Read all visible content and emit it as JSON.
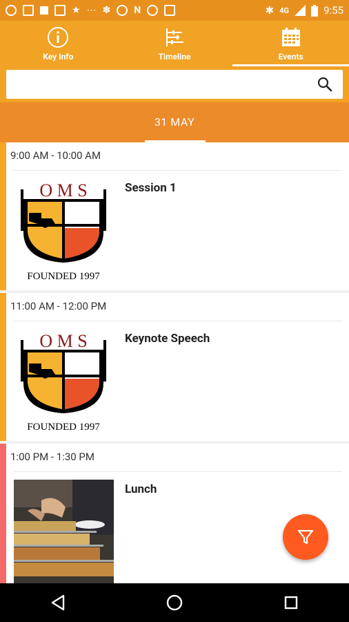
{
  "status_bar": {
    "time": "9:55",
    "network": "4G",
    "left_icons": [
      "whatsapp-icon",
      "gmail-icon",
      "square-icon",
      "gmail-icon",
      "star-icon",
      "dots-icon",
      "paw-icon",
      "reddit-icon",
      "n-icon",
      "google-icon",
      "news-icon"
    ],
    "right_icons": [
      "bluetooth-icon",
      "signal-icon",
      "battery-icon"
    ]
  },
  "tabs": [
    {
      "label": "Key Info",
      "icon": "info-icon",
      "active": false
    },
    {
      "label": "Timeline",
      "icon": "timeline-icon",
      "active": false
    },
    {
      "label": "Events",
      "icon": "calendar-icon",
      "active": true
    }
  ],
  "search": {
    "placeholder": "",
    "value": "",
    "icon": "search-icon"
  },
  "date_tab": {
    "label": "31 MAY"
  },
  "events": [
    {
      "time": "9:00 AM - 10:00 AM",
      "title": "Session 1",
      "image": "oms-logo",
      "stripe_color": "#f5a623"
    },
    {
      "time": "11:00 AM - 12:00 PM",
      "title": "Keynote Speech",
      "image": "oms-logo",
      "stripe_color": "#f5a623"
    },
    {
      "time": "1:00 PM - 1:30 PM",
      "title": "Lunch",
      "image": "buffet-photo",
      "stripe_color": "#f46a6a"
    }
  ],
  "logo_text": {
    "letters": "O M S",
    "founded": "FOUNDED 1997"
  },
  "fab": {
    "icon": "filter-icon",
    "color": "#ff5a1f"
  },
  "nav": [
    "back-icon",
    "home-icon",
    "recents-icon"
  ],
  "colors": {
    "header": "#f0a324",
    "date_bar": "#ec8b2a",
    "accent": "#ff5a1f"
  }
}
